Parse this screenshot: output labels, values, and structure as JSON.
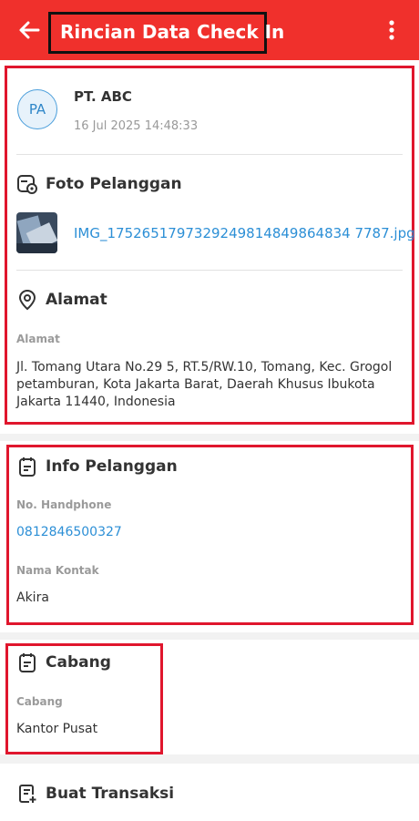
{
  "header": {
    "title": "Rincian Data Check In",
    "back_icon": "arrow-left-icon",
    "menu_icon": "more-vert-icon",
    "background": "#f0302c"
  },
  "customer": {
    "avatar_initials": "PA",
    "name": "PT. ABC",
    "checkin_time": "16 Jul 2025 14:48:33"
  },
  "photo": {
    "section_title": "Foto Pelanggan",
    "filename": "IMG_1752651797329249814849864834 7787.jpg"
  },
  "address": {
    "section_title": "Alamat",
    "label": "Alamat",
    "value": "Jl. Tomang Utara No.29 5, RT.5/RW.10, Tomang, Kec. Grogol petamburan, Kota Jakarta Barat, Daerah Khusus Ibukota Jakarta 11440, Indonesia"
  },
  "info": {
    "section_title": "Info Pelanggan",
    "phone_label": "No. Handphone",
    "phone_value": "0812846500327",
    "contact_label": "Nama Kontak",
    "contact_value": "Akira"
  },
  "branch": {
    "section_title": "Cabang",
    "label": "Cabang",
    "value": "Kantor Pusat"
  },
  "transaction": {
    "section_title": "Buat Transaksi"
  },
  "colors": {
    "accent": "#f0302c",
    "highlight_frame": "#e0162d",
    "link": "#2c8fd6"
  }
}
